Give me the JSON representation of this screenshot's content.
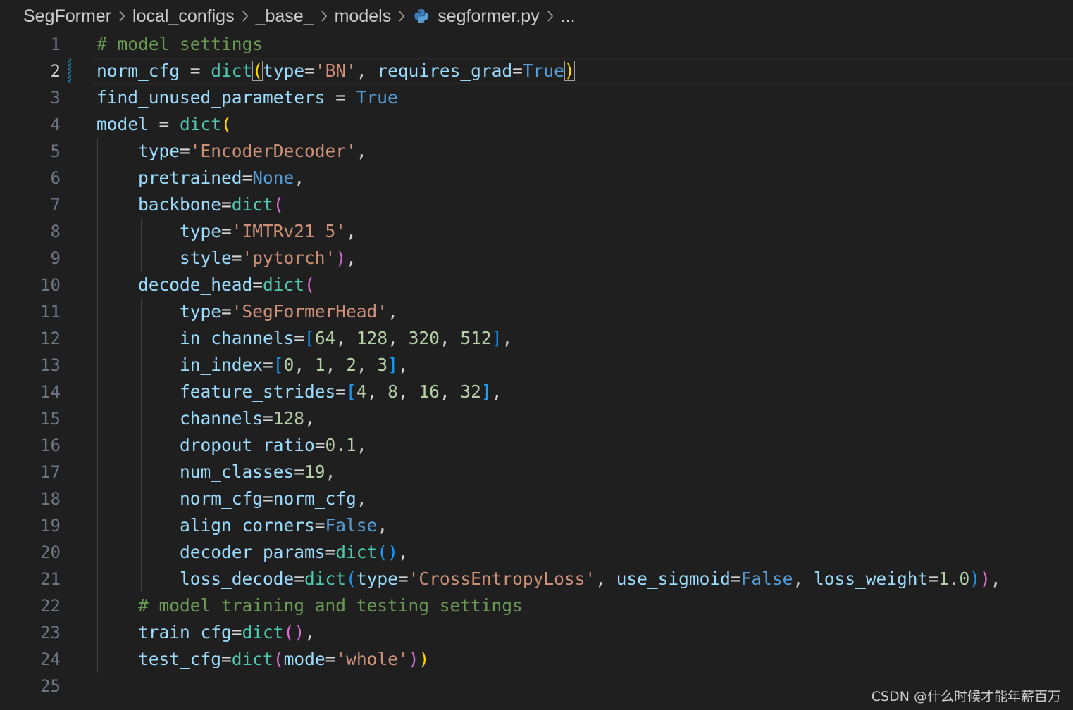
{
  "breadcrumb": {
    "items": [
      "SegFormer",
      "local_configs",
      "_base_",
      "models",
      "segformer.py",
      "..."
    ]
  },
  "code_lines": [
    {
      "n": "1",
      "tokens": [
        [
          "# model settings",
          "cm"
        ]
      ]
    },
    {
      "n": "2",
      "tokens": [
        [
          "norm_cfg",
          "var"
        ],
        [
          " = ",
          "op"
        ],
        [
          "dict",
          "fn"
        ],
        [
          "(",
          "p1m"
        ],
        [
          "type",
          "var"
        ],
        [
          "=",
          "op"
        ],
        [
          "'BN'",
          "str"
        ],
        [
          ", ",
          "op"
        ],
        [
          "requires_grad",
          "var"
        ],
        [
          "=",
          "op"
        ],
        [
          "True",
          "kw"
        ],
        [
          ")",
          "p1m"
        ]
      ]
    },
    {
      "n": "3",
      "tokens": [
        [
          "find_unused_parameters",
          "var"
        ],
        [
          " = ",
          "op"
        ],
        [
          "True",
          "kw"
        ]
      ]
    },
    {
      "n": "4",
      "tokens": [
        [
          "model",
          "var"
        ],
        [
          " = ",
          "op"
        ],
        [
          "dict",
          "fn"
        ],
        [
          "(",
          "p1"
        ]
      ]
    },
    {
      "n": "5",
      "tokens": [
        [
          "    ",
          "op"
        ],
        [
          "type",
          "var"
        ],
        [
          "=",
          "op"
        ],
        [
          "'EncoderDecoder'",
          "str"
        ],
        [
          ",",
          "op"
        ]
      ]
    },
    {
      "n": "6",
      "tokens": [
        [
          "    ",
          "op"
        ],
        [
          "pretrained",
          "var"
        ],
        [
          "=",
          "op"
        ],
        [
          "None",
          "kw"
        ],
        [
          ",",
          "op"
        ]
      ]
    },
    {
      "n": "7",
      "tokens": [
        [
          "    ",
          "op"
        ],
        [
          "backbone",
          "var"
        ],
        [
          "=",
          "op"
        ],
        [
          "dict",
          "fn"
        ],
        [
          "(",
          "p2"
        ]
      ]
    },
    {
      "n": "8",
      "tokens": [
        [
          "        ",
          "op"
        ],
        [
          "type",
          "var"
        ],
        [
          "=",
          "op"
        ],
        [
          "'IMTRv21_5'",
          "str"
        ],
        [
          ",",
          "op"
        ]
      ]
    },
    {
      "n": "9",
      "tokens": [
        [
          "        ",
          "op"
        ],
        [
          "style",
          "var"
        ],
        [
          "=",
          "op"
        ],
        [
          "'pytorch'",
          "str"
        ],
        [
          ")",
          "p2"
        ],
        [
          ",",
          "op"
        ]
      ]
    },
    {
      "n": "10",
      "tokens": [
        [
          "    ",
          "op"
        ],
        [
          "decode_head",
          "var"
        ],
        [
          "=",
          "op"
        ],
        [
          "dict",
          "fn"
        ],
        [
          "(",
          "p2"
        ]
      ]
    },
    {
      "n": "11",
      "tokens": [
        [
          "        ",
          "op"
        ],
        [
          "type",
          "var"
        ],
        [
          "=",
          "op"
        ],
        [
          "'SegFormerHead'",
          "str"
        ],
        [
          ",",
          "op"
        ]
      ]
    },
    {
      "n": "12",
      "tokens": [
        [
          "        ",
          "op"
        ],
        [
          "in_channels",
          "var"
        ],
        [
          "=",
          "op"
        ],
        [
          "[",
          "p3"
        ],
        [
          "64",
          "num"
        ],
        [
          ", ",
          "op"
        ],
        [
          "128",
          "num"
        ],
        [
          ", ",
          "op"
        ],
        [
          "320",
          "num"
        ],
        [
          ", ",
          "op"
        ],
        [
          "512",
          "num"
        ],
        [
          "]",
          "p3"
        ],
        [
          ",",
          "op"
        ]
      ]
    },
    {
      "n": "13",
      "tokens": [
        [
          "        ",
          "op"
        ],
        [
          "in_index",
          "var"
        ],
        [
          "=",
          "op"
        ],
        [
          "[",
          "p3"
        ],
        [
          "0",
          "num"
        ],
        [
          ", ",
          "op"
        ],
        [
          "1",
          "num"
        ],
        [
          ", ",
          "op"
        ],
        [
          "2",
          "num"
        ],
        [
          ", ",
          "op"
        ],
        [
          "3",
          "num"
        ],
        [
          "]",
          "p3"
        ],
        [
          ",",
          "op"
        ]
      ]
    },
    {
      "n": "14",
      "tokens": [
        [
          "        ",
          "op"
        ],
        [
          "feature_strides",
          "var"
        ],
        [
          "=",
          "op"
        ],
        [
          "[",
          "p3"
        ],
        [
          "4",
          "num"
        ],
        [
          ", ",
          "op"
        ],
        [
          "8",
          "num"
        ],
        [
          ", ",
          "op"
        ],
        [
          "16",
          "num"
        ],
        [
          ", ",
          "op"
        ],
        [
          "32",
          "num"
        ],
        [
          "]",
          "p3"
        ],
        [
          ",",
          "op"
        ]
      ]
    },
    {
      "n": "15",
      "tokens": [
        [
          "        ",
          "op"
        ],
        [
          "channels",
          "var"
        ],
        [
          "=",
          "op"
        ],
        [
          "128",
          "num"
        ],
        [
          ",",
          "op"
        ]
      ]
    },
    {
      "n": "16",
      "tokens": [
        [
          "        ",
          "op"
        ],
        [
          "dropout_ratio",
          "var"
        ],
        [
          "=",
          "op"
        ],
        [
          "0.1",
          "num"
        ],
        [
          ",",
          "op"
        ]
      ]
    },
    {
      "n": "17",
      "tokens": [
        [
          "        ",
          "op"
        ],
        [
          "num_classes",
          "var"
        ],
        [
          "=",
          "op"
        ],
        [
          "19",
          "num"
        ],
        [
          ",",
          "op"
        ]
      ]
    },
    {
      "n": "18",
      "tokens": [
        [
          "        ",
          "op"
        ],
        [
          "norm_cfg",
          "var"
        ],
        [
          "=",
          "op"
        ],
        [
          "norm_cfg",
          "var"
        ],
        [
          ",",
          "op"
        ]
      ]
    },
    {
      "n": "19",
      "tokens": [
        [
          "        ",
          "op"
        ],
        [
          "align_corners",
          "var"
        ],
        [
          "=",
          "op"
        ],
        [
          "False",
          "kw"
        ],
        [
          ",",
          "op"
        ]
      ]
    },
    {
      "n": "20",
      "tokens": [
        [
          "        ",
          "op"
        ],
        [
          "decoder_params",
          "var"
        ],
        [
          "=",
          "op"
        ],
        [
          "dict",
          "fn"
        ],
        [
          "()",
          "p3"
        ],
        [
          ",",
          "op"
        ]
      ]
    },
    {
      "n": "21",
      "tokens": [
        [
          "        ",
          "op"
        ],
        [
          "loss_decode",
          "var"
        ],
        [
          "=",
          "op"
        ],
        [
          "dict",
          "fn"
        ],
        [
          "(",
          "p3"
        ],
        [
          "type",
          "var"
        ],
        [
          "=",
          "op"
        ],
        [
          "'CrossEntropyLoss'",
          "str"
        ],
        [
          ", ",
          "op"
        ],
        [
          "use_sigmoid",
          "var"
        ],
        [
          "=",
          "op"
        ],
        [
          "False",
          "kw"
        ],
        [
          ", ",
          "op"
        ],
        [
          "loss_weight",
          "var"
        ],
        [
          "=",
          "op"
        ],
        [
          "1.0",
          "num"
        ],
        [
          ")",
          "p3"
        ],
        [
          ")",
          "p2"
        ],
        [
          ",",
          "op"
        ]
      ]
    },
    {
      "n": "22",
      "tokens": [
        [
          "    ",
          "op"
        ],
        [
          "# model training and testing settings",
          "cm"
        ]
      ]
    },
    {
      "n": "23",
      "tokens": [
        [
          "    ",
          "op"
        ],
        [
          "train_cfg",
          "var"
        ],
        [
          "=",
          "op"
        ],
        [
          "dict",
          "fn"
        ],
        [
          "()",
          "p2"
        ],
        [
          ",",
          "op"
        ]
      ]
    },
    {
      "n": "24",
      "tokens": [
        [
          "    ",
          "op"
        ],
        [
          "test_cfg",
          "var"
        ],
        [
          "=",
          "op"
        ],
        [
          "dict",
          "fn"
        ],
        [
          "(",
          "p2"
        ],
        [
          "mode",
          "var"
        ],
        [
          "=",
          "op"
        ],
        [
          "'whole'",
          "str"
        ],
        [
          ")",
          "p2"
        ],
        [
          ")",
          "p1"
        ]
      ]
    },
    {
      "n": "25",
      "tokens": []
    }
  ],
  "current_line": "2",
  "watermark": "CSDN @什么时候才能年薪百万",
  "colors": {
    "background": "#1f1f1f",
    "comment": "#6a9955",
    "variable": "#9cdcfe",
    "function": "#4ec9b0",
    "string": "#ce9178",
    "keyword": "#569cd6",
    "number": "#b5cea8",
    "bracket_1": "#ffd700",
    "bracket_2": "#da70d6",
    "bracket_3": "#179fff"
  }
}
